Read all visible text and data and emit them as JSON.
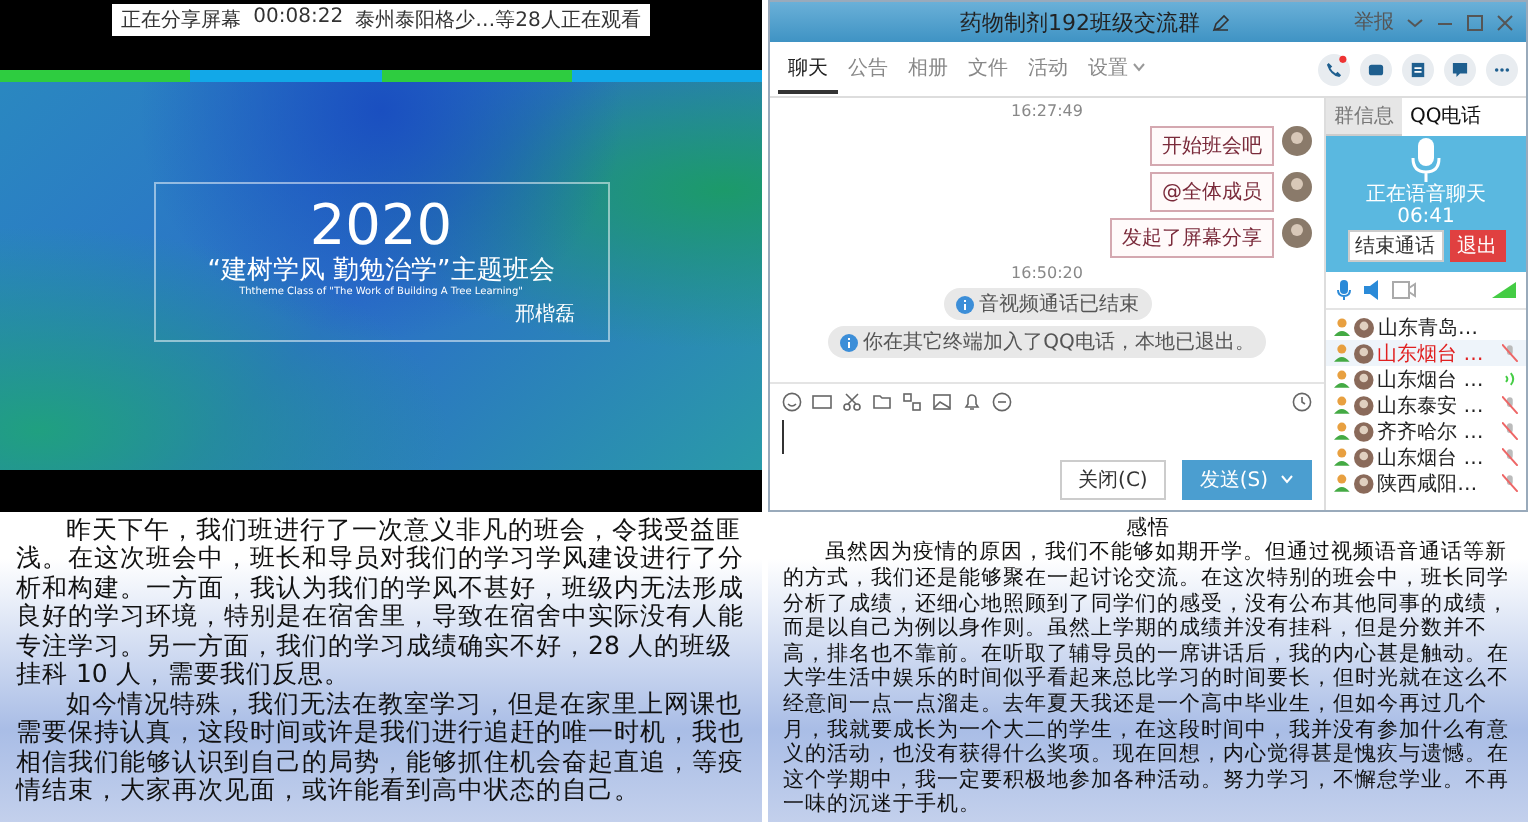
{
  "share_bar": {
    "status": "正在分享屏幕",
    "duration": "00:08:22",
    "viewers": "泰州泰阳格少…等28人正在观看"
  },
  "slide": {
    "year": "2020",
    "title": "“建树学风 勤勉治学”主题班会",
    "subtitle": "Ththeme Class of \"The Work of Building A Tree Learning\"",
    "author": "邢楷磊"
  },
  "chat_window": {
    "title": "药物制剂192班级交流群",
    "report": "举报",
    "tabs": [
      {
        "label": "聊天",
        "selected": true,
        "dropdown": false
      },
      {
        "label": "公告",
        "selected": false,
        "dropdown": false
      },
      {
        "label": "相册",
        "selected": false,
        "dropdown": false
      },
      {
        "label": "文件",
        "selected": false,
        "dropdown": false
      },
      {
        "label": "活动",
        "selected": false,
        "dropdown": false
      },
      {
        "label": "设置",
        "selected": false,
        "dropdown": true
      }
    ],
    "messages": [
      {
        "kind": "time",
        "text": "16:27:49"
      },
      {
        "kind": "bubble",
        "text": "开始班会吧"
      },
      {
        "kind": "bubble",
        "text": "@全体成员"
      },
      {
        "kind": "bubble",
        "text": "发起了屏幕分享"
      },
      {
        "kind": "time",
        "text": "16:50:20"
      },
      {
        "kind": "system",
        "text": "音视频通话已结束"
      },
      {
        "kind": "system",
        "text": "你在其它终端加入了QQ电话，本地已退出。"
      }
    ],
    "close_button": "关闭(C)",
    "send_button": "发送(S)",
    "side_tabs": [
      {
        "label": "群信息",
        "selected": false
      },
      {
        "label": "QQ电话",
        "selected": true
      }
    ],
    "call": {
      "status": "正在语音聊天",
      "time": "06:41",
      "end_button": "结束通话",
      "exit_button": "退出"
    },
    "members": [
      {
        "name": "山东青岛…",
        "selected": false,
        "kind": "idle"
      },
      {
        "name": "山东烟台 …",
        "selected": true,
        "kind": "muted"
      },
      {
        "name": "山东烟台 …",
        "selected": false,
        "kind": "speaking"
      },
      {
        "name": "山东泰安 …",
        "selected": false,
        "kind": "muted"
      },
      {
        "name": "齐齐哈尔 …",
        "selected": false,
        "kind": "muted"
      },
      {
        "name": "山东烟台 …",
        "selected": false,
        "kind": "muted"
      },
      {
        "name": "陕西咸阳…",
        "selected": false,
        "kind": "muted"
      }
    ]
  },
  "notes": [
    {
      "paragraphs": [
        "昨天下午，我们班进行了一次意义非凡的班会，令我受益匪浅。在这次班会中，班长和导员对我们的学习学风建设进行了分析和构建。一方面，我认为我们的学风不甚好，班级内无法形成良好的学习环境，特别是在宿舍里，导致在宿舍中实际没有人能专注学习。另一方面，我们的学习成绩确实不好，28 人的班级挂科 10 人，需要我们反思。",
        "如今情况特殊，我们无法在教室学习，但是在家里上网课也需要保持认真，这段时间或许是我们进行追赶的唯一时机，我也相信我们能够认识到自己的局势，能够抓住机会奋起直追，等疫情结束，大家再次见面，或许能看到高中状态的自己。"
      ]
    },
    {
      "title": "感悟",
      "paragraphs": [
        "虽然因为疫情的原因，我们不能够如期开学。但通过视频语音通话等新的方式，我们还是能够聚在一起讨论交流。在这次特别的班会中，班长同学分析了成绩，还细心地照顾到了同学们的感受，没有公布其他同事的成绩，而是以自己为例以身作则。虽然上学期的成绩并没有挂科，但是分数并不高，排名也不靠前。在听取了辅导员的一席讲话后，我的内心甚是触动。在大学生活中娱乐的时间似乎看起来总比学习的时间要长，但时光就在这么不经意间一点一点溜走。去年夏天我还是一个高中毕业生，但如今再过几个月，我就要成长为一个大二的学生，在这段时间中，我并没有参加什么有意义的活动，也没有获得什么奖项。现在回想，内心觉得甚是愧疚与遗憾。在这个学期中，我一定要积极地参加各种活动。努力学习，不懈怠学业。不再一味的沉迷于手机。"
      ]
    }
  ]
}
